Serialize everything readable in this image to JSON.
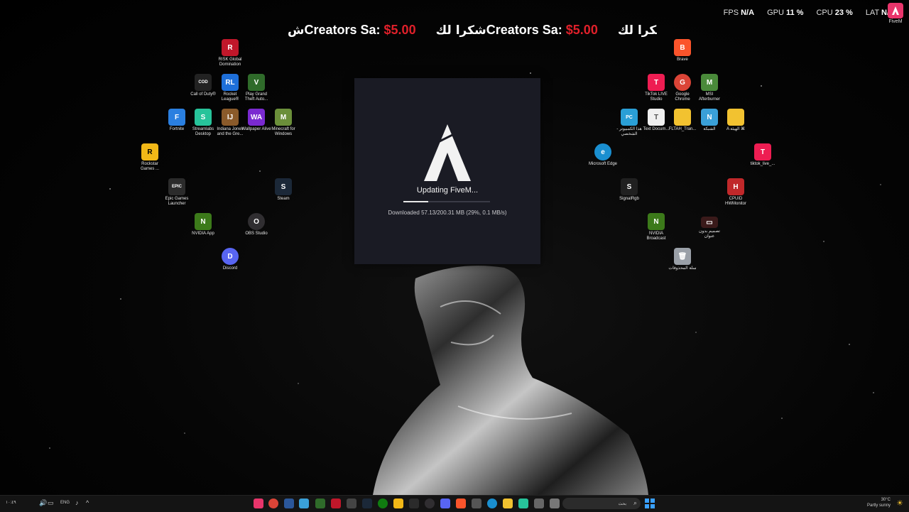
{
  "overlay": {
    "ticker": [
      {
        "arabic": "ش",
        "label": "Creators Sa:",
        "amount": "$5.00"
      },
      {
        "arabic": "شكرا لك",
        "label": "Creators Sa:",
        "amount": "$5.00"
      },
      {
        "arabic": "شكرا لك",
        "label": "",
        "amount": ""
      }
    ],
    "fps_label": "FPS",
    "fps_value": "N/A",
    "gpu_label": "GPU",
    "gpu_value": "11 %",
    "cpu_label": "CPU",
    "cpu_value": "23 %",
    "lat_label": "LAT",
    "lat_value": "N/A"
  },
  "corner_app": {
    "label": "FiveM"
  },
  "desktop_icons": [
    {
      "label": "RISK Global Domination",
      "color": "#c0172a",
      "glyph": "R"
    },
    {
      "label": "Call of Duty®",
      "color": "#222222",
      "glyph": "COD"
    },
    {
      "label": "Rocket League®",
      "color": "#1e6fd9",
      "glyph": "RL"
    },
    {
      "label": "Play Grand Theft Auto...",
      "color": "#2f6b2a",
      "glyph": "V"
    },
    {
      "label": "Fortnite",
      "color": "#2a7fe0",
      "glyph": "F"
    },
    {
      "label": "Streamlabs Desktop",
      "color": "#27c39a",
      "glyph": "S"
    },
    {
      "label": "Indiana Jones and the Gre...",
      "color": "#8a5a2a",
      "glyph": "IJ"
    },
    {
      "label": "Wallpaper Alive",
      "color": "#7a2ad0",
      "glyph": "WA"
    },
    {
      "label": "Minecraft for Windows",
      "color": "#6b8f3a",
      "glyph": "M"
    },
    {
      "label": "Rockstar Games ...",
      "color": "#f2b817",
      "glyph": "R"
    },
    {
      "label": "Epic Games Launcher",
      "color": "#2b2b2b",
      "glyph": "EPIC"
    },
    {
      "label": "Steam",
      "color": "#1b2838",
      "glyph": "S"
    },
    {
      "label": "NVIDIA App",
      "color": "#3c7a1a",
      "glyph": "N"
    },
    {
      "label": "OBS Studio",
      "color": "#302e31",
      "glyph": "O"
    },
    {
      "label": "Discord",
      "color": "#5865f2",
      "glyph": "D"
    },
    {
      "label": "Brave",
      "color": "#fb542b",
      "glyph": "B"
    },
    {
      "label": "TikTok LIVE Studio",
      "color": "#ee1d52",
      "glyph": "T"
    },
    {
      "label": "Google Chrome",
      "color": "#db4437",
      "glyph": "G"
    },
    {
      "label": "MSI Afterburner",
      "color": "#4a8a3a",
      "glyph": "M"
    },
    {
      "label": "هذا الكمبيوتر - الشخصي",
      "color": "#2a9fd6",
      "glyph": "PC"
    },
    {
      "label": "Text Docum...",
      "color": "#f0f0f0",
      "glyph": "T"
    },
    {
      "label": "FLTAH_Tran...",
      "color": "#f2c230",
      "glyph": ""
    },
    {
      "label": "الشبكة",
      "color": "#3aa0d8",
      "glyph": "N"
    },
    {
      "label": "A الهيئة ⌘",
      "color": "#f2c230",
      "glyph": ""
    },
    {
      "label": "Microsoft Edge",
      "color": "#1a8fd0",
      "glyph": "e"
    },
    {
      "label": "tiktok_live_...",
      "color": "#ee1d52",
      "glyph": "T"
    },
    {
      "label": "SignalRgb",
      "color": "#202020",
      "glyph": "S"
    },
    {
      "label": "CPUID HWMonitor",
      "color": "#c0282a",
      "glyph": "H"
    },
    {
      "label": "NVIDIA Broadcast",
      "color": "#3c7a1a",
      "glyph": "N"
    },
    {
      "label": "تصميم بدون عنوان",
      "color": "#3a1a1a",
      "glyph": "▭"
    },
    {
      "label": "سلة المحذوفات",
      "color": "#9aa0a8",
      "glyph": "🗑"
    }
  ],
  "updater": {
    "title": "Updating FiveM...",
    "status": "Downloaded 57.13/200.31 MB (29%, 0.1 MB/s)",
    "progress": 0.29
  },
  "taskbar": {
    "lang": "ENG",
    "search_placeholder": "بحث",
    "weather_temp": "30°C",
    "weather_text": "Partly sunny",
    "clock": "١٠:٤٩"
  }
}
